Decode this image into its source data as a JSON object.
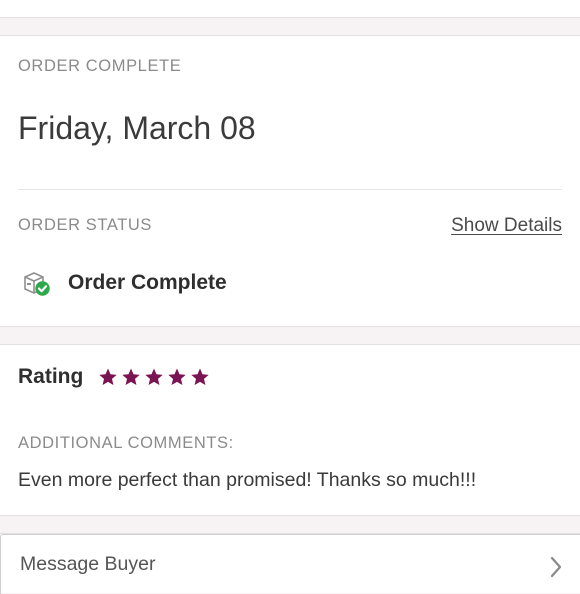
{
  "order": {
    "heading": "ORDER COMPLETE",
    "date": "Friday, March 08",
    "status_heading": "ORDER STATUS",
    "show_details_label": "Show Details",
    "status_icon": "package-check-icon",
    "status_text": "Order Complete"
  },
  "rating": {
    "label": "Rating",
    "stars": 5,
    "max_stars": 5,
    "star_icon": "star-icon",
    "star_color": "#7a1452",
    "comments_heading": "ADDITIONAL COMMENTS:",
    "comment": "Even more perfect than promised! Thanks so much!!!"
  },
  "message": {
    "label": "Message Buyer",
    "chevron_icon": "chevron-right-icon"
  },
  "colors": {
    "page_background": "#f7f2f3",
    "card_background": "#ffffff",
    "check_green": "#2ea84a"
  }
}
